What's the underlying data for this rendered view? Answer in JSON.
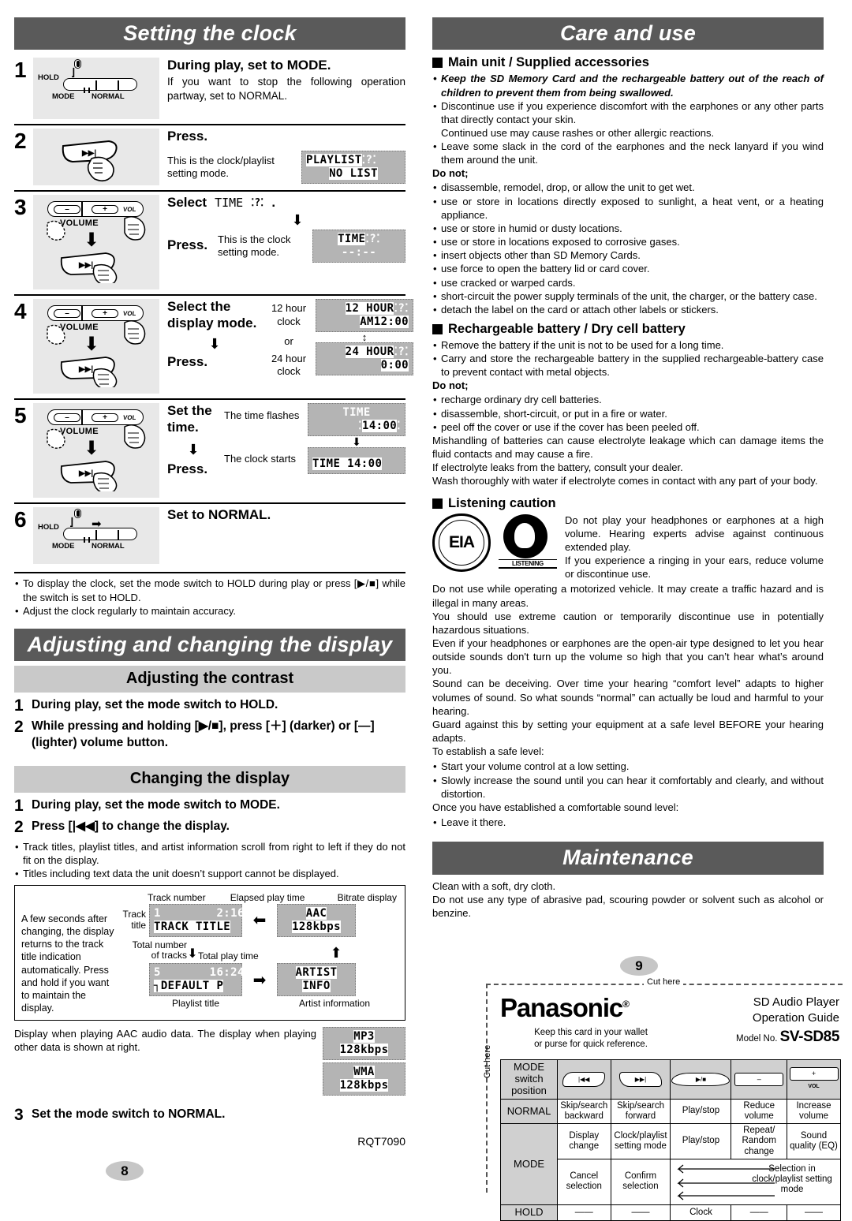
{
  "left": {
    "section1_title": "Setting the clock",
    "steps": [
      {
        "num": "1",
        "heading": "During play, set to MODE.",
        "body": "If you want to stop the following operation partway, set to NORMAL.",
        "switch": {
          "hold": "HOLD",
          "mode": "MODE",
          "normal": "NORMAL"
        }
      },
      {
        "num": "2",
        "heading": "Press.",
        "caption": "This is the clock/playlist setting mode.",
        "lcd_line1": "PLAYLIST",
        "lcd_line1_suffix": "─☀─",
        "lcd_line2": "NO LIST"
      },
      {
        "num": "3",
        "heading_pre": "Select",
        "heading_lcd": "TIME",
        "heading_post": ".",
        "press": "Press.",
        "caption": "This is the clock setting mode.",
        "lcd_line1": "TIME",
        "lcd_line2": "--:--"
      },
      {
        "num": "4",
        "heading": "Select the display mode.",
        "press": "Press.",
        "label_12": "12 hour clock",
        "label_or": "or",
        "label_24": "24 hour clock",
        "lcd_12_line1": "12 HOUR",
        "lcd_12_line2": "AM12:00",
        "lcd_24_line1": "24 HOUR",
        "lcd_24_line2": "0:00"
      },
      {
        "num": "5",
        "heading": "Set the time.",
        "press": "Press.",
        "caption1": "The time flashes",
        "caption2": "The clock starts",
        "lcd_a_line1": "TIME",
        "lcd_a_line2": "14:00",
        "lcd_b": "TIME 14:00"
      },
      {
        "num": "6",
        "heading": "Set to NORMAL.",
        "switch": {
          "hold": "HOLD",
          "mode": "MODE",
          "normal": "NORMAL"
        }
      }
    ],
    "notes": [
      "To display the clock, set the mode switch to HOLD during play or press [▶/■] while the switch is set to HOLD.",
      "Adjust the clock regularly to maintain accuracy."
    ],
    "volume_label": "VOLUME",
    "vol_minus": "–",
    "vol_plus": "+",
    "vol_sub": "VOL",
    "skip_glyph": "▶▶|",
    "section2_title": "Adjusting and changing the display",
    "sub1_title": "Adjusting the contrast",
    "contrast_steps": [
      {
        "num": "1",
        "text": "During play, set the mode switch to HOLD."
      },
      {
        "num": "2",
        "text": "While pressing and holding [▶/■], press [＋] (darker) or [—] (lighter) volume button."
      }
    ],
    "sub2_title": "Changing the display",
    "display_steps": [
      {
        "num": "1",
        "text": "During play, set the mode switch to MODE."
      },
      {
        "num": "2",
        "text": "Press [|◀◀] to change the display."
      }
    ],
    "display_notes": [
      "Track titles, playlist titles, and artist information scroll from right to left if they do not fit on the display.",
      "Titles including text data the unit doesn’t support cannot be displayed."
    ],
    "dbox": {
      "side_text": "A few seconds after changing, the display returns to the track title indication automatically. Press and hold if you want to maintain the display.",
      "lbl_track_number": "Track number",
      "lbl_elapsed": "Elapsed play time",
      "lbl_bitrate": "Bitrate display",
      "lbl_track": "Track",
      "lbl_title": "title",
      "lbl_total_number": "Total number",
      "lbl_of_tracks": "of tracks",
      "lbl_total_play": "Total play time",
      "lbl_playlist_title": "Playlist title",
      "lbl_artist_information": "Artist information",
      "lcd_track_top": "1        2:16",
      "lcd_track_bottom": "TRACK TITLE",
      "lcd_codec_top": "AAC",
      "lcd_codec_bottom": "128kbps",
      "lcd_total_top": "5       16:24",
      "lcd_total_bottom": "┐DEFAULT P",
      "lcd_artist_top": "ARTIST",
      "lcd_artist_bottom": "INFO"
    },
    "aac_note": "Display when playing AAC audio data. The display when playing other data is shown at right.",
    "lcd_mp3_top": "MP3",
    "lcd_mp3_bottom": "128kbps",
    "lcd_wma_top": "WMA",
    "lcd_wma_bottom": "128kbps",
    "final_step": {
      "num": "3",
      "text": "Set the mode switch to NORMAL."
    },
    "rqt": "RQT7090",
    "page_number": "8"
  },
  "right": {
    "section1_title": "Care and use",
    "h1": "Main unit / Supplied accessories",
    "bullets1": [
      "Keep the SD Memory Card and the rechargeable battery out of the reach of children to prevent them from being swallowed.",
      "Discontinue use if you experience discomfort with the earphones or any other parts that directly contact your skin.",
      "Continued use may cause rashes or other allergic reactions.",
      "Leave some slack in the cord of the earphones and the neck lanyard if you wind them around the unit."
    ],
    "donot1_label": "Do not;",
    "donot1": [
      "disassemble, remodel, drop, or allow the unit to get wet.",
      "use or store in locations directly exposed to sunlight, a heat vent, or a heating appliance.",
      "use or store in humid or dusty locations.",
      "use or store in locations exposed to corrosive gases.",
      "insert objects other than SD Memory Cards.",
      "use force to open the battery lid or card cover.",
      "use cracked or warped cards.",
      "short-circuit the power supply terminals of the unit, the charger, or the battery case.",
      "detach the label on the card or attach other labels or stickers."
    ],
    "h2": "Rechargeable battery / Dry cell battery",
    "bullets2": [
      "Remove the battery if the unit is not to be used for a long time.",
      "Carry and store the rechargeable battery in the supplied rechargeable-battery case to prevent contact with metal objects."
    ],
    "donot2_label": "Do not;",
    "donot2": [
      "recharge ordinary dry cell batteries.",
      "disassemble, short-circuit, or put in a fire or water.",
      "peel off the cover or use if the cover has been peeled off."
    ],
    "paras2": [
      "Mishandling of batteries can cause electrolyte leakage which can damage items the fluid contacts and may cause a fire.",
      "If electrolyte leaks from the battery, consult your dealer.",
      "Wash thoroughly with water if electrolyte comes in contact with any part  of your body."
    ],
    "h3": "Listening caution",
    "logo_eia": "EIA",
    "logo_listening": "LISTENING",
    "listening_right": [
      "Do not play your headphones or earphones at a high volume. Hearing experts advise against continuous extended play.",
      "If you experience a ringing in your ears, reduce volume or discontinue use."
    ],
    "listening_paras": [
      "Do not use while operating a motorized vehicle. It may create a traffic hazard and is illegal in many areas.",
      "You should use extreme caution or temporarily discontinue use in potentially hazardous situations.",
      "Even if your headphones or earphones are the open-air type designed to let you hear outside sounds don't turn up the volume so high that you can’t hear what’s around you.",
      "Sound can be deceiving. Over time your hearing “comfort level” adapts to higher volumes of sound. So what sounds “normal” can actually be loud and harmful to your hearing.",
      "Guard against this by setting your equipment at a safe level BEFORE your hearing adapts.",
      "To establish a safe level:"
    ],
    "safe_bullets": [
      "Start your volume control at a low setting.",
      "Slowly increase the sound until you can hear it comfortably and clearly, and without distortion."
    ],
    "safe_tail": "Once you have established a comfortable sound level:",
    "safe_tail_bullet": "Leave it there.",
    "section2_title": "Maintenance",
    "maint": [
      "Clean with a soft, dry cloth.",
      "Do not use any type of abrasive pad, scouring powder or solvent such as alcohol or benzine."
    ],
    "page_number": "9"
  },
  "card": {
    "cut_here_top": "Cut here",
    "cut_here_side": "Cut here",
    "brand": "Panasonic",
    "brand_reg": "®",
    "keep_line1": "Keep this card in your wallet",
    "keep_line2": "or purse for quick reference.",
    "product_line1": "SD Audio Player",
    "product_line2": "Operation Guide",
    "model_label": "Model No.",
    "model": "SV-SD85",
    "table": {
      "corner_line1": "MODE switch",
      "corner_line2": "position",
      "icons": [
        "|◀◀",
        "▶▶|",
        "▶/■",
        "–",
        "+"
      ],
      "icon_vol": "VOL",
      "rows": [
        {
          "label": "NORMAL",
          "cells": [
            "Skip/search backward",
            "Skip/search forward",
            "Play/stop",
            "Reduce volume",
            "Increase volume"
          ]
        },
        {
          "label": "MODE",
          "cells": [
            "Display change",
            "Clock/playlist setting mode",
            "Play/stop",
            "Repeat/ Random change",
            "Sound quality (EQ)"
          ]
        },
        {
          "label": "",
          "cells": [
            "Cancel selection",
            "Confirm selection",
            "",
            "Selection in clock/playlist setting mode",
            ""
          ]
        },
        {
          "label": "HOLD",
          "cells": [
            "——",
            "——",
            "Clock",
            "——",
            "——"
          ]
        }
      ]
    }
  }
}
